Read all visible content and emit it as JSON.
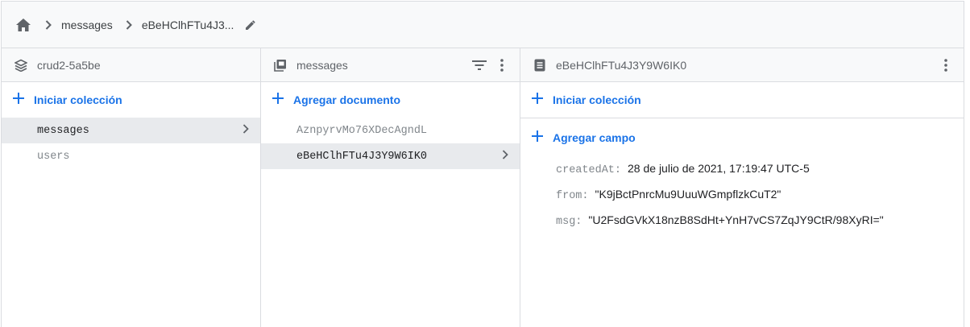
{
  "breadcrumb": {
    "items": [
      "messages",
      "eBeHClhFTu4J3..."
    ]
  },
  "columns": {
    "root": {
      "title": "crud2-5a5be",
      "action_label": "Iniciar colección",
      "items": [
        "messages",
        "users"
      ],
      "selected": "messages"
    },
    "collection": {
      "title": "messages",
      "action_label": "Agregar documento",
      "items": [
        "AznpyrvMo76XDecAgndL",
        "eBeHClhFTu4J3Y9W6IK0"
      ],
      "selected": "eBeHClhFTu4J3Y9W6IK0"
    },
    "document": {
      "title": "eBeHClhFTu4J3Y9W6IK0",
      "action_collection_label": "Iniciar colección",
      "action_field_label": "Agregar campo",
      "fields": [
        {
          "key": "createdAt:",
          "value": "28 de julio de 2021, 17:19:47 UTC-5"
        },
        {
          "key": "from:",
          "value": "\"K9jBctPnrcMu9UuuWGmpflzkCuT2\""
        },
        {
          "key": "msg:",
          "value": "\"U2FsdGVkX18nzB8SdHt+YnH7vCS7ZqJY9CtR/98XyRI=\""
        }
      ]
    }
  },
  "icons": {
    "home": "home-icon",
    "chevron": "chevron-right-icon",
    "edit": "pencil-icon",
    "database": "database-icon",
    "collection": "collection-icon",
    "document": "document-icon",
    "filter": "filter-icon",
    "more": "more-vert-icon",
    "add": "plus-icon"
  },
  "colors": {
    "accent": "#1a73e8",
    "selected_bg": "#e8eaed",
    "header_bg": "#f8f9fa",
    "border": "#dadce0"
  }
}
